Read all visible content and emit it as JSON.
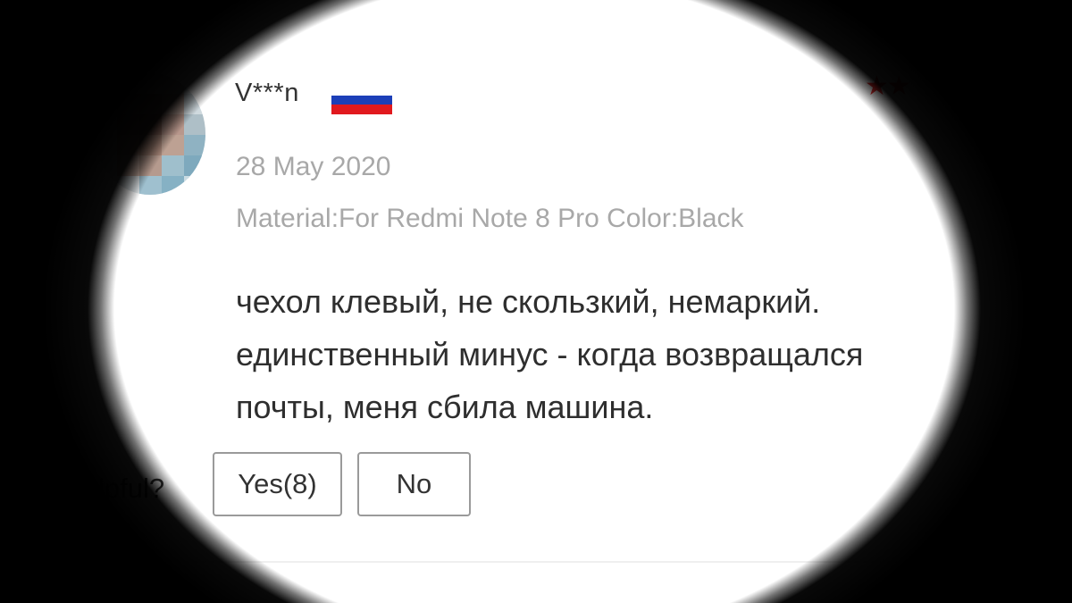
{
  "review": {
    "username": "V***n",
    "country_flag": "russia-flag-icon",
    "flag_colors": [
      "#ffffff",
      "#1c3fb8",
      "#e1191e"
    ],
    "stars_visible": "★★",
    "star_color": "#e62e2e",
    "date": "28 May 2020",
    "sku": "Material:For Redmi Note 8 Pro Color:Black",
    "comment_lines": [
      "чехол клевый, не скользкий, немаркий.",
      "единственный минус - когда возвращался",
      "почты, меня сбила машина."
    ],
    "helpful_label": "lpful?",
    "yes_label": "Yes(8)",
    "no_label": "No"
  }
}
